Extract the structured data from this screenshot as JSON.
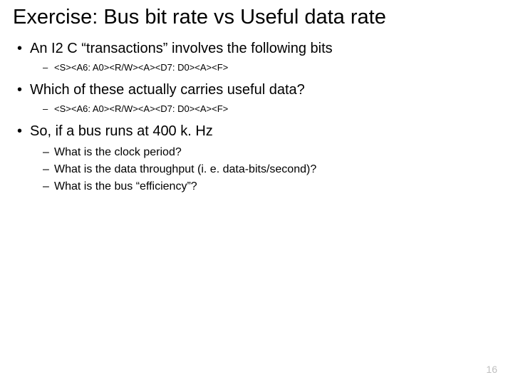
{
  "title": "Exercise: Bus bit rate vs Useful data rate",
  "bullets": {
    "b1": "An I2 C “transactions” involves the following bits",
    "b1_sub": "<S><A6: A0><R/W><A><D7: D0><A><F>",
    "b2": "Which of these actually carries useful data?",
    "b2_sub": "<S><A6: A0><R/W><A><D7: D0><A><F>",
    "b3": "So, if a bus runs at 400 k. Hz",
    "b3_sub1": "What is the clock period?",
    "b3_sub2": "What is the data throughput (i. e. data-bits/second)?",
    "b3_sub3": "What is the bus “efficiency”?"
  },
  "page_number": "16"
}
